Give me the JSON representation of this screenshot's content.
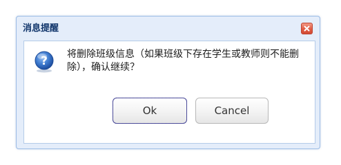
{
  "dialog": {
    "title": "消息提醒",
    "message": "将删除班级信息（如果班级下存在学生或教师则不能删除），确认继续？",
    "ok_label": "Ok",
    "cancel_label": "Cancel"
  },
  "icons": {
    "question": "question-icon",
    "close": "close-icon"
  },
  "colors": {
    "title_text": "#10356b",
    "close_button": "#e05c45",
    "window_border": "#9cbce5",
    "question_icon": "#2a63b5"
  }
}
